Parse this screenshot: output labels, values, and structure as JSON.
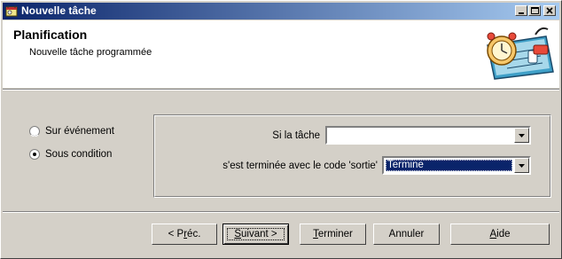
{
  "window": {
    "title": "Nouvelle tâche",
    "icon": "scheduler-icon",
    "controls": [
      "minimize-icon",
      "maximize-icon",
      "close-icon"
    ]
  },
  "header": {
    "title": "Planification",
    "subtitle": "Nouvelle tâche programmée",
    "art": "scheduler-notepad-clock-icon"
  },
  "options": [
    {
      "label": "Sur événement",
      "selected": false
    },
    {
      "label": "Sous condition",
      "selected": true
    }
  ],
  "condition": {
    "task_label": "Si la tâche",
    "task_value": "",
    "code_label": "s'est terminée avec le code 'sortie'",
    "code_value": "Termine"
  },
  "buttons": {
    "prev": {
      "pre": "< P",
      "ul": "r",
      "post": "éc."
    },
    "next": {
      "pre": "",
      "ul": "S",
      "post": "uivant >"
    },
    "finish": {
      "pre": "",
      "ul": "T",
      "post": "erminer"
    },
    "cancel": {
      "pre": "",
      "ul": "",
      "post": "Annuler"
    },
    "help": {
      "pre": "",
      "ul": "A",
      "post": "ide"
    }
  }
}
